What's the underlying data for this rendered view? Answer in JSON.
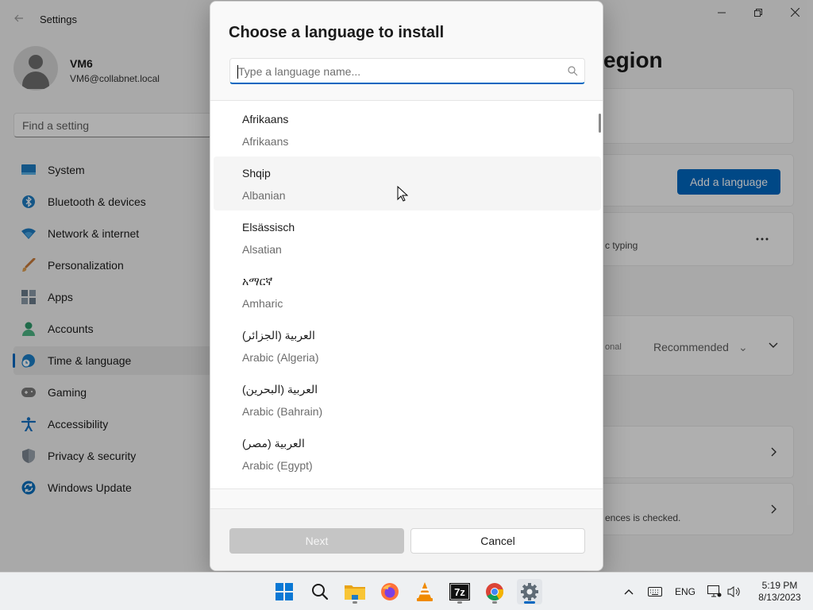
{
  "window": {
    "title": "Settings",
    "back_icon": "arrow-left-icon",
    "minimize_icon": "minimize-icon",
    "maximize_icon": "maximize-icon",
    "close_icon": "close-icon"
  },
  "user": {
    "name": "VM6",
    "email": "VM6@collabnet.local"
  },
  "search": {
    "placeholder": "Find a setting"
  },
  "sidebar": {
    "items": [
      {
        "label": "System",
        "icon": "monitor-icon",
        "color": "#0a6fbd"
      },
      {
        "label": "Bluetooth & devices",
        "icon": "bluetooth-icon",
        "color": "#0a6fbd"
      },
      {
        "label": "Network & internet",
        "icon": "wifi-icon",
        "color": "#0a6fbd"
      },
      {
        "label": "Personalization",
        "icon": "brush-icon",
        "color": "#d07a2e"
      },
      {
        "label": "Apps",
        "icon": "apps-icon",
        "color": "#5a6b7a"
      },
      {
        "label": "Accounts",
        "icon": "person-icon",
        "color": "#2e9a6a"
      },
      {
        "label": "Time & language",
        "icon": "globe-clock-icon",
        "color": "#1a7fc7",
        "active": true
      },
      {
        "label": "Gaming",
        "icon": "gamepad-icon",
        "color": "#6b6b6b"
      },
      {
        "label": "Accessibility",
        "icon": "accessibility-icon",
        "color": "#1570c2"
      },
      {
        "label": "Privacy & security",
        "icon": "shield-icon",
        "color": "#7c8691"
      },
      {
        "label": "Windows Update",
        "icon": "update-icon",
        "color": "#0a6fbd"
      }
    ]
  },
  "main": {
    "page_title_partial": "egion",
    "add_language_label": "Add a language",
    "typing_partial": "c typing",
    "optional_partial": "onal",
    "recommended_label": "Recommended",
    "checked_partial": "ences is checked."
  },
  "dialog": {
    "title": "Choose a language to install",
    "search_placeholder": "Type a language name...",
    "languages": [
      {
        "native": "Afrikaans",
        "english": "Afrikaans"
      },
      {
        "native": "Shqip",
        "english": "Albanian"
      },
      {
        "native": "Elsässisch",
        "english": "Alsatian"
      },
      {
        "native": "አማርኛ",
        "english": "Amharic"
      },
      {
        "native": "العربية (الجزائر)",
        "english": "Arabic (Algeria)"
      },
      {
        "native": "العربية (البحرين)",
        "english": "Arabic (Bahrain)"
      },
      {
        "native": "العربية (مصر)",
        "english": "Arabic (Egypt)"
      }
    ],
    "next_label": "Next",
    "cancel_label": "Cancel"
  },
  "taskbar": {
    "apps": [
      {
        "name": "start-icon"
      },
      {
        "name": "search-icon"
      },
      {
        "name": "file-explorer-icon"
      },
      {
        "name": "firefox-icon"
      },
      {
        "name": "vlc-icon"
      },
      {
        "name": "7zip-icon",
        "label": "7z"
      },
      {
        "name": "chrome-icon"
      },
      {
        "name": "settings-gear-icon",
        "active": true
      }
    ],
    "input_language": "ENG",
    "time": "5:19 PM",
    "date": "8/13/2023"
  },
  "colors": {
    "accent": "#0067c0",
    "disabled_button": "#c5c5c5"
  }
}
